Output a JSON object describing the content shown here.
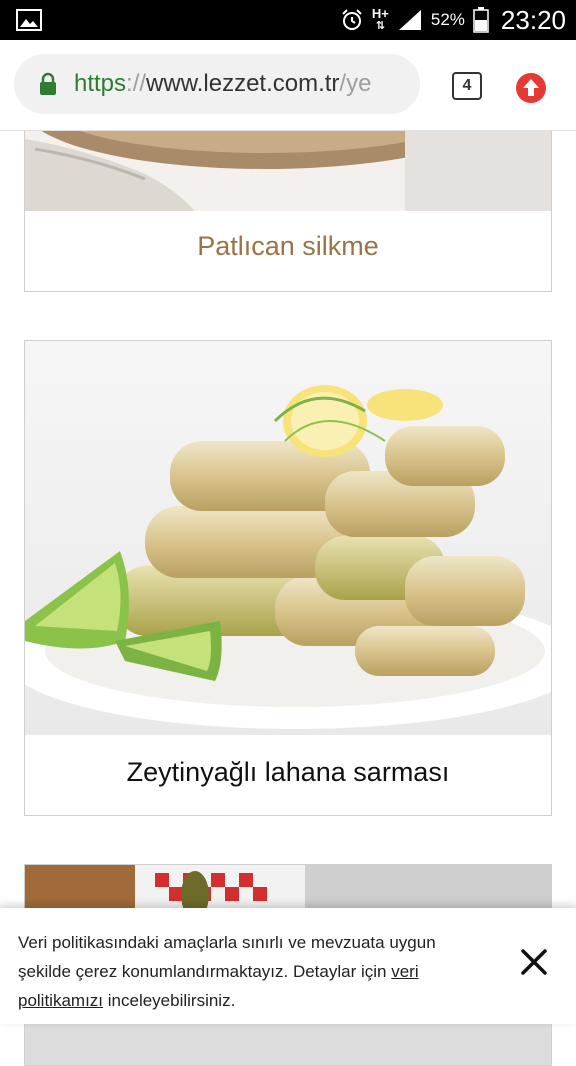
{
  "status_bar": {
    "battery_percent": "52%",
    "time": "23:20",
    "network": "H+",
    "icons": [
      "image-icon",
      "alarm-icon",
      "signal-icon",
      "battery-icon"
    ]
  },
  "browser": {
    "url_scheme": "https",
    "url_separator": "://",
    "url_host": "www.lezzet.com.tr",
    "url_path": "/ye",
    "tab_count": "4",
    "icons": [
      "lock-icon",
      "tabs-icon",
      "update-icon"
    ],
    "colors": {
      "secure": "#2e7d32",
      "update": "#e53935"
    }
  },
  "recipes": [
    {
      "title": "Patlıcan silkme",
      "title_color": "#9a7446"
    },
    {
      "title": "Zeytinyağlı lahana sarması",
      "title_color": "#111111"
    }
  ],
  "cookie_banner": {
    "text_before_link": "Veri politikasındaki amaçlarla sınırlı ve mevzuata uygun şekilde çerez konumlandırmaktayız. Detaylar için ",
    "link_text": "veri politikamızı",
    "text_after_link": " inceleyebilirsiniz.",
    "close_icon": "close-icon"
  }
}
